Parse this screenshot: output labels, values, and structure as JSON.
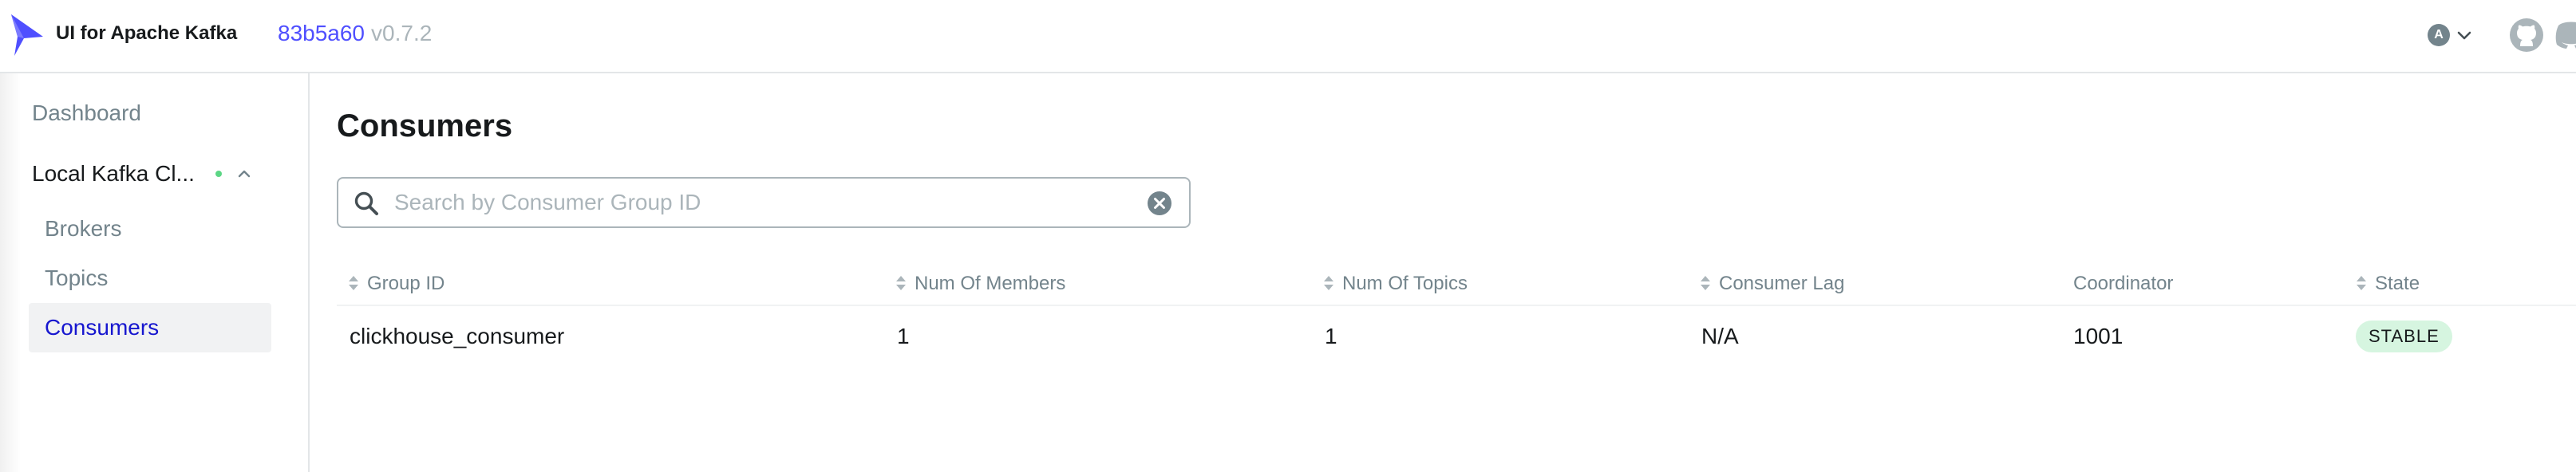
{
  "header": {
    "app_title": "UI for Apache Kafka",
    "version_hash": "83b5a60",
    "version_tag": "v0.7.2",
    "user_avatar_letter": "A",
    "logo_color": "#4F4FFF"
  },
  "sidebar": {
    "dashboard_label": "Dashboard",
    "cluster": {
      "label": "Local Kafka Cl...",
      "status_color": "#5CD685",
      "expanded": true
    },
    "items": [
      {
        "label": "Brokers",
        "active": false
      },
      {
        "label": "Topics",
        "active": false
      },
      {
        "label": "Consumers",
        "active": true
      }
    ]
  },
  "main": {
    "title": "Consumers",
    "search": {
      "placeholder": "Search by Consumer Group ID",
      "value": ""
    },
    "table": {
      "columns": [
        {
          "label": "Group ID",
          "sortable": true
        },
        {
          "label": "Num Of Members",
          "sortable": true
        },
        {
          "label": "Num Of Topics",
          "sortable": true
        },
        {
          "label": "Consumer Lag",
          "sortable": true
        },
        {
          "label": "Coordinator",
          "sortable": false
        },
        {
          "label": "State",
          "sortable": true
        }
      ],
      "rows": [
        {
          "group_id": "clickhouse_consumer",
          "num_members": "1",
          "num_topics": "1",
          "consumer_lag": "N/A",
          "coordinator": "1001",
          "state": "STABLE",
          "state_color": "#D6F5E0"
        }
      ]
    }
  }
}
